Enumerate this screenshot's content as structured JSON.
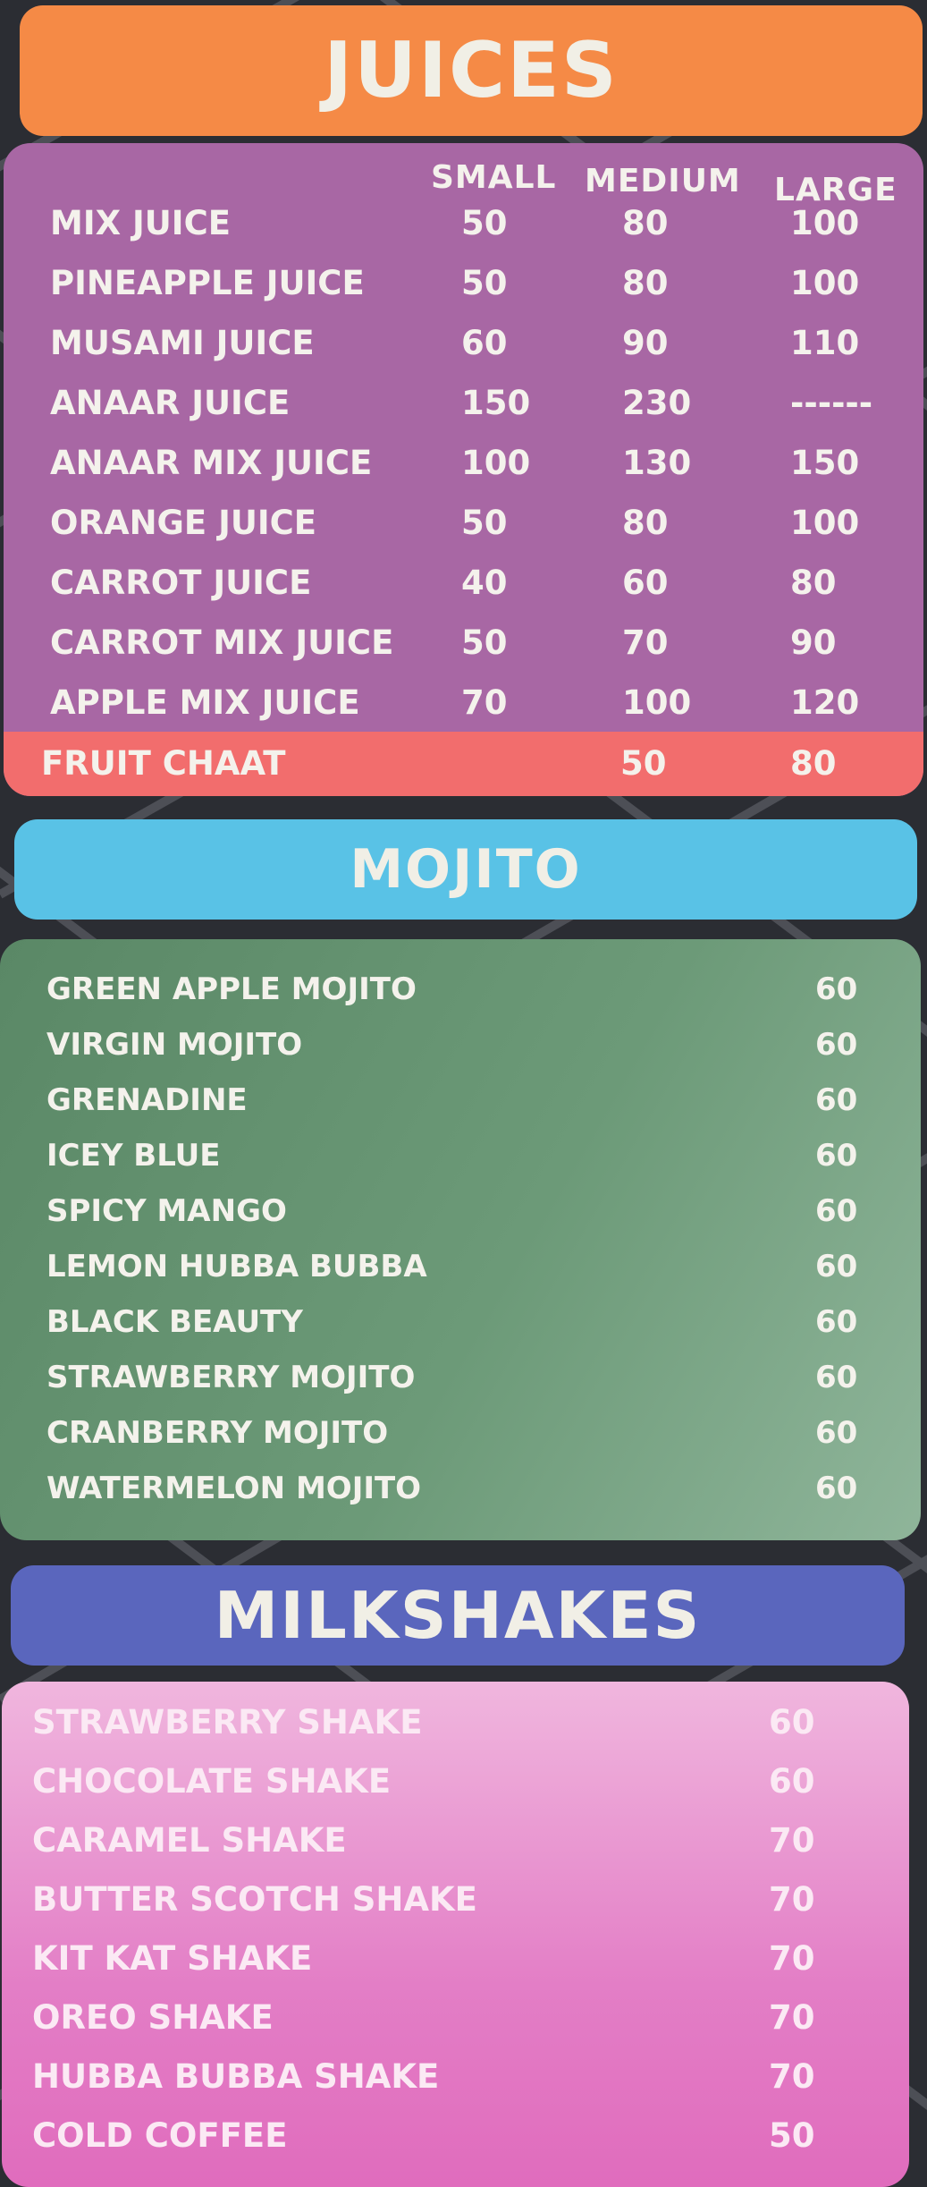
{
  "colors": {
    "background": "#2b2d33",
    "juices_banner": "#f58a46",
    "juices_panel": "#a867a4",
    "fruit_chaat_strip": "#f26d6d",
    "mojito_banner": "#59c2e6",
    "mojito_panel": "#5f8f6b",
    "milkshakes_banner": "#5a66bd",
    "milkshakes_panel": "#e580c8",
    "text": "#f4f2ec"
  },
  "juices": {
    "title": "JUICES",
    "headers": {
      "small": "SMALL",
      "medium": "MEDIUM",
      "large": "LARGE"
    },
    "items": [
      {
        "name": "MIX JUICE",
        "small": "50",
        "medium": "80",
        "large": "100"
      },
      {
        "name": "PINEAPPLE JUICE",
        "small": "50",
        "medium": "80",
        "large": "100"
      },
      {
        "name": "MUSAMI JUICE",
        "small": "60",
        "medium": "90",
        "large": "110"
      },
      {
        "name": "ANAAR JUICE",
        "small": "150",
        "medium": "230",
        "large": "------"
      },
      {
        "name": "ANAAR MIX JUICE",
        "small": "100",
        "medium": "130",
        "large": "150"
      },
      {
        "name": "ORANGE JUICE",
        "small": "50",
        "medium": "80",
        "large": "100"
      },
      {
        "name": "CARROT JUICE",
        "small": "40",
        "medium": "60",
        "large": "80"
      },
      {
        "name": "CARROT MIX JUICE",
        "small": "50",
        "medium": "70",
        "large": "90"
      },
      {
        "name": "APPLE MIX JUICE",
        "small": "70",
        "medium": "100",
        "large": "120"
      }
    ],
    "fruit_chaat": {
      "name": "FRUIT CHAAT",
      "medium": "50",
      "large": "80"
    }
  },
  "mojito": {
    "title": "MOJITO",
    "items": [
      {
        "name": "GREEN APPLE MOJITO",
        "price": "60"
      },
      {
        "name": "VIRGIN MOJITO",
        "price": "60"
      },
      {
        "name": "GRENADINE",
        "price": "60"
      },
      {
        "name": "ICEY BLUE",
        "price": "60"
      },
      {
        "name": "SPICY MANGO",
        "price": "60"
      },
      {
        "name": "LEMON HUBBA BUBBA",
        "price": "60"
      },
      {
        "name": "BLACK BEAUTY",
        "price": "60"
      },
      {
        "name": "STRAWBERRY MOJITO",
        "price": "60"
      },
      {
        "name": "CRANBERRY MOJITO",
        "price": "60"
      },
      {
        "name": "WATERMELON MOJITO",
        "price": "60"
      }
    ]
  },
  "milkshakes": {
    "title": "MILKSHAKES",
    "items": [
      {
        "name": "STRAWBERRY SHAKE",
        "price": "60"
      },
      {
        "name": "CHOCOLATE SHAKE",
        "price": "60"
      },
      {
        "name": "CARAMEL SHAKE",
        "price": "70"
      },
      {
        "name": "BUTTER SCOTCH SHAKE",
        "price": "70"
      },
      {
        "name": "KIT KAT SHAKE",
        "price": "70"
      },
      {
        "name": "OREO SHAKE",
        "price": "70"
      },
      {
        "name": "HUBBA BUBBA SHAKE",
        "price": "70"
      },
      {
        "name": "COLD COFFEE",
        "price": "50"
      }
    ]
  }
}
